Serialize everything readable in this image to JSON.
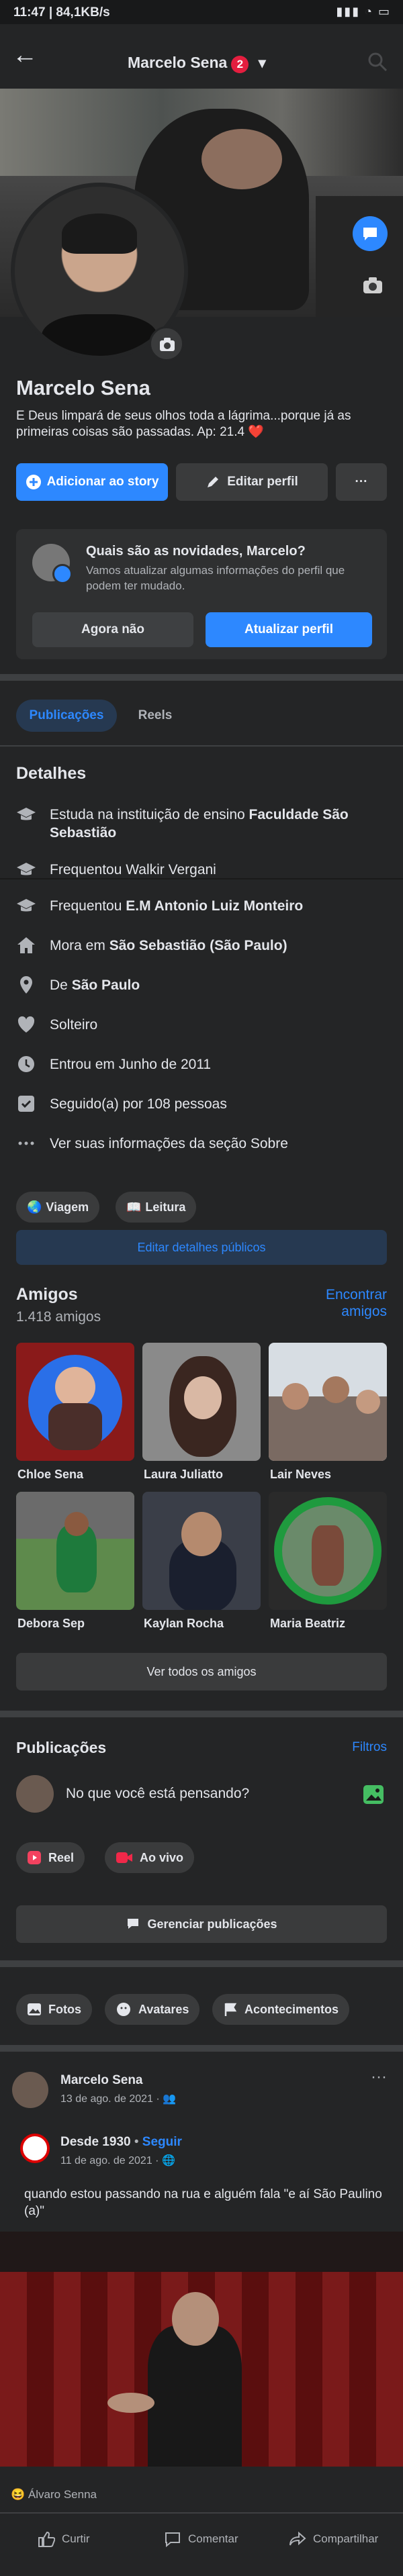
{
  "status_bar": {
    "time": "11:47",
    "speed": "84,1KB/s",
    "right": "▮▮▮ ◔ ▭"
  },
  "header": {
    "back_glyph": "←",
    "title": "Marcelo Sena",
    "badge": "2",
    "caret": "▾"
  },
  "profile": {
    "name": "Marcelo Sena",
    "bio": "E Deus limpará de seus olhos toda a lágrima...porque já as primeiras coisas são passadas. Ap: 21.4 ❤️",
    "add_story": "Adicionar ao story",
    "edit_profile": "Editar perfil",
    "more": "···"
  },
  "update_card": {
    "title": "Quais são as novidades, Marcelo?",
    "text": "Vamos atualizar algumas informações do perfil que podem ter mudado.",
    "not_now": "Agora não",
    "update": "Atualizar perfil"
  },
  "tabs": {
    "posts": "Publicações",
    "reels": "Reels"
  },
  "details": {
    "heading": "Detalhes",
    "items": [
      {
        "prefix": "Estuda na instituição de ensino ",
        "bold": "Faculdade São Sebastião",
        "icon": "graduation-cap-icon"
      },
      {
        "prefix": "Frequentou Walkir Vergani",
        "bold": "",
        "icon": "graduation-cap-icon"
      },
      {
        "prefix": "Frequentou ",
        "bold": "E.M Antonio Luiz Monteiro",
        "icon": "graduation-cap-icon"
      },
      {
        "prefix": "Mora em ",
        "bold": "São Sebastião (São Paulo)",
        "icon": "home-icon"
      },
      {
        "prefix": "De ",
        "bold": "São Paulo",
        "icon": "location-pin-icon"
      },
      {
        "prefix": "Solteiro",
        "bold": "",
        "icon": "heart-icon"
      },
      {
        "prefix": "Entrou em Junho de 2011",
        "bold": "",
        "icon": "clock-icon"
      },
      {
        "prefix": "Seguido(a) por 108 pessoas",
        "bold": "",
        "icon": "followers-icon"
      },
      {
        "prefix": "Ver suas informações da seção Sobre",
        "bold": "",
        "icon": "more-dots-icon"
      }
    ],
    "chips": [
      {
        "emoji": "🌏",
        "label": "Viagem"
      },
      {
        "emoji": "📖",
        "label": "Leitura"
      }
    ],
    "edit_public": "Editar detalhes públicos"
  },
  "friends": {
    "heading": "Amigos",
    "count": "1.418 amigos",
    "find": "Encontrar amigos",
    "find_line1": "Encontrar",
    "find_line2": "amigos",
    "list": [
      {
        "name": "Chloe Sena"
      },
      {
        "name": "Laura Juliatto"
      },
      {
        "name": "Lair Neves"
      },
      {
        "name": "Debora Sep"
      },
      {
        "name": "Kaylan Rocha"
      },
      {
        "name": "Maria Beatriz"
      }
    ],
    "see_all": "Ver todos os amigos"
  },
  "posts": {
    "heading": "Publicações",
    "filters": "Filtros",
    "composer_placeholder": "No que você está pensando?",
    "reel": "Reel",
    "live": "Ao vivo",
    "manage": "Gerenciar publicações",
    "chips": [
      "Fotos",
      "Avatares",
      "Acontecimentos"
    ]
  },
  "post": {
    "author": "Marcelo Sena",
    "date": "13 de ago. de 2021",
    "shared_page": "Desde 1930",
    "follow": "Seguir",
    "shared_date": "11 de ago. de 2021",
    "text": "quando estou passando na rua e alguém fala \"e aí São Paulino (a)\"",
    "reactions": "Álvaro Senna",
    "like": "Curtir",
    "comment": "Comentar",
    "share": "Compartilhar"
  },
  "colors": {
    "accent": "#2d88ff",
    "background": "#242526",
    "card": "#3a3b3c",
    "badge": "#e41e3f"
  }
}
